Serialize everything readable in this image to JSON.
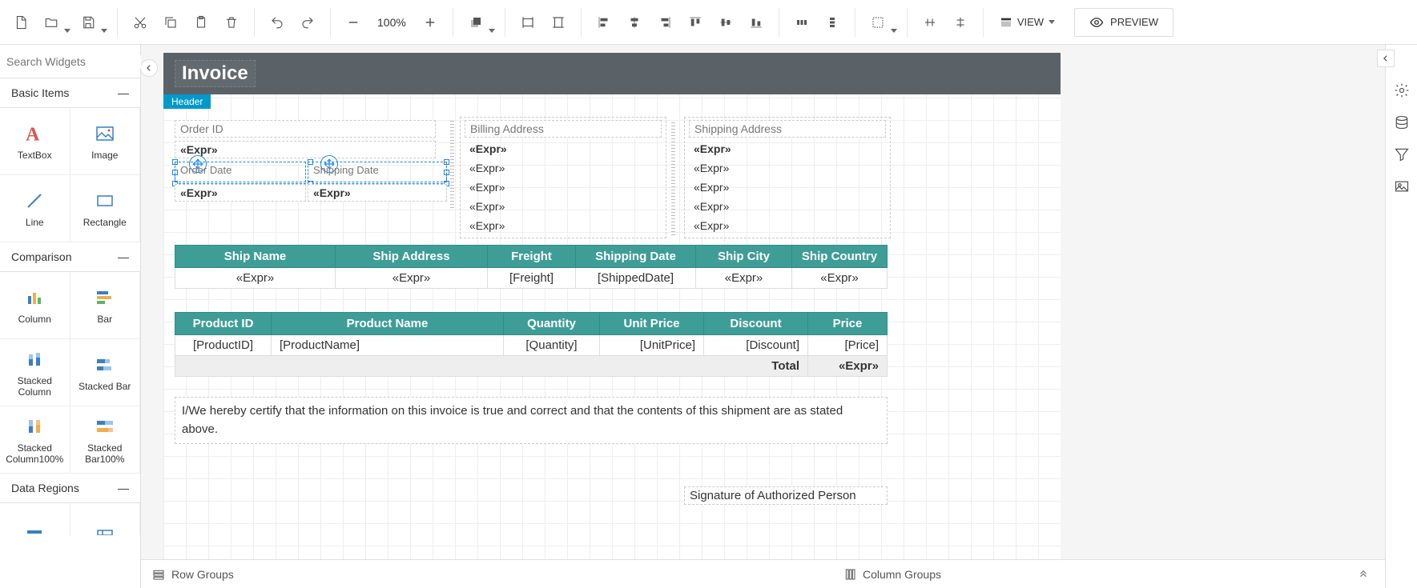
{
  "toolbar": {
    "zoom": "100%",
    "view_label": "VIEW",
    "preview_label": "PREVIEW"
  },
  "search": {
    "placeholder": "Search Widgets"
  },
  "categories": {
    "basic": {
      "title": "Basic Items",
      "items": [
        "TextBox",
        "Image",
        "Line",
        "Rectangle"
      ]
    },
    "comparison": {
      "title": "Comparison",
      "items": [
        "Column",
        "Bar",
        "Stacked Column",
        "Stacked Bar",
        "Stacked Column100%",
        "Stacked Bar100%"
      ]
    },
    "dataregions": {
      "title": "Data Regions"
    }
  },
  "report": {
    "title": "Invoice",
    "header_tag": "Header",
    "order_id_label": "Order ID",
    "order_id_val": "«Expr»",
    "order_date_label": "Order Date",
    "order_date_val": "«Expr»",
    "shipping_date_label": "Shipping Date",
    "shipping_date_val": "«Expr»",
    "billing": {
      "title": "Billing Address",
      "lines": [
        "«Expr»",
        "«Expr»",
        "«Expr»",
        "«Expr»",
        "«Expr»"
      ]
    },
    "shipping": {
      "title": "Shipping Address",
      "lines": [
        "«Expr»",
        "«Expr»",
        "«Expr»",
        "«Expr»",
        "«Expr»"
      ]
    },
    "table1": {
      "headers": [
        "Ship Name",
        "Ship Address",
        "Freight",
        "Shipping Date",
        "Ship City",
        "Ship Country"
      ],
      "row": [
        "«Expr»",
        "«Expr»",
        "[Freight]",
        "[ShippedDate]",
        "«Expr»",
        "«Expr»"
      ]
    },
    "table2": {
      "headers": [
        "Product ID",
        "Product Name",
        "Quantity",
        "Unit Price",
        "Discount",
        "Price"
      ],
      "row": [
        "[ProductID]",
        "[ProductName]",
        "[Quantity]",
        "[UnitPrice]",
        "[Discount]",
        "[Price]"
      ],
      "total_label": "Total",
      "total_val": "«Expr»"
    },
    "cert": "I/We hereby certify that the information on this invoice is true and correct and that the contents of this shipment are as stated above.",
    "signature": "Signature of Authorized Person"
  },
  "footer": {
    "row_groups": "Row Groups",
    "col_groups": "Column Groups"
  }
}
